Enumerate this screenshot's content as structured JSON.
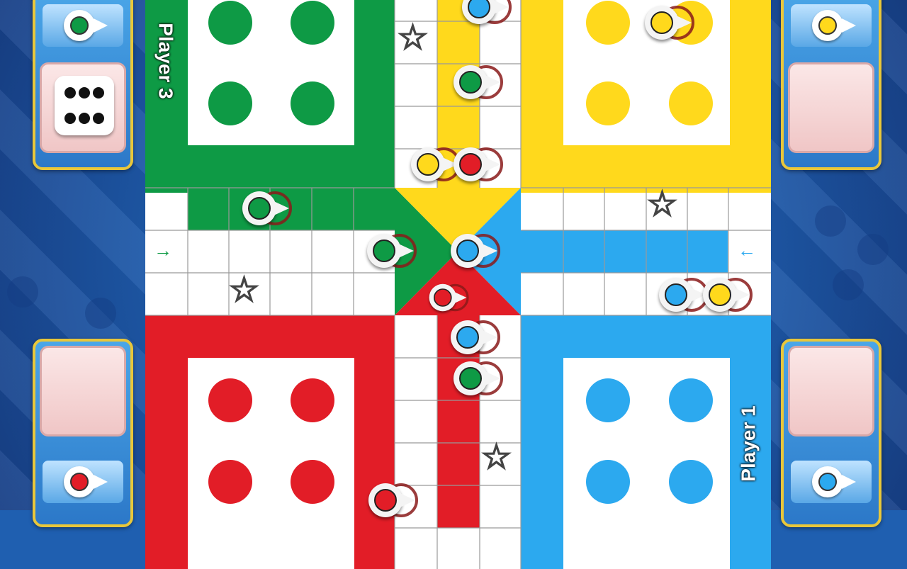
{
  "players": [
    {
      "id": "player-3",
      "label": "Player 3",
      "color": "#0e9a45"
    },
    {
      "id": "player-1",
      "label": "Player 1",
      "color": "#29a9ef"
    }
  ],
  "colors": {
    "green": "#0e9a45",
    "yellow": "#ffd91c",
    "red": "#e21d27",
    "blue": "#2ca9ef",
    "board_bg": "#ffffff",
    "panel_border": "#e9c73a"
  },
  "dice": {
    "top_left_value": 6
  },
  "panels": {
    "top_left": {
      "pawn_color": "green",
      "has_dice": true
    },
    "top_right": {
      "pawn_color": "yellow",
      "has_dice": false
    },
    "bottom_left": {
      "pawn_color": "red",
      "has_dice": false
    },
    "bottom_right": {
      "pawn_color": "blue",
      "has_dice": false
    }
  },
  "arrows": {
    "left": "→",
    "right": "←"
  },
  "star_glyph": "☆",
  "icons": {
    "pawn": "pawn-icon",
    "dice": "dice-icon",
    "star": "star-icon",
    "arrow": "arrow-icon"
  }
}
